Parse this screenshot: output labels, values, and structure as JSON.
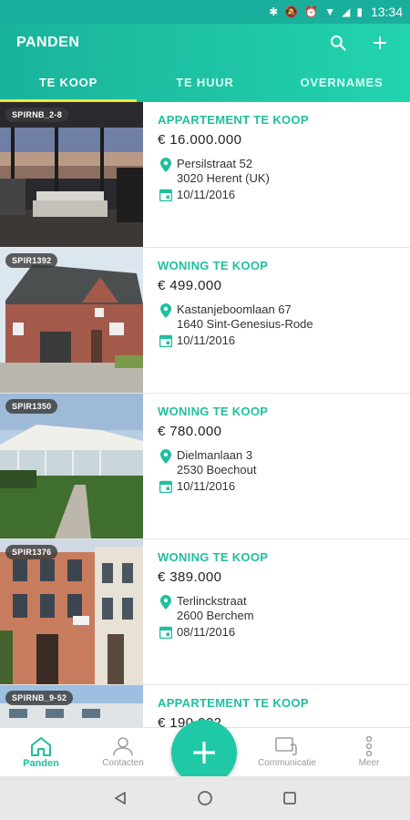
{
  "status": {
    "time": "13:34"
  },
  "appbar": {
    "title": "PANDEN"
  },
  "tabs": [
    {
      "label": "TE KOOP",
      "active": true
    },
    {
      "label": "TE HUUR",
      "active": false
    },
    {
      "label": "OVERNAMES",
      "active": false
    }
  ],
  "listings": [
    {
      "code": "SPIRNB_2-8",
      "type": "APPARTEMENT TE KOOP",
      "price": "€ 16.000.000",
      "street": "Persilstraat 52",
      "city": "3020 Herent (UK)",
      "date": "10/11/2016"
    },
    {
      "code": "SPIR1392",
      "type": "WONING TE KOOP",
      "price": "€ 499.000",
      "street": "Kastanjeboomlaan 67",
      "city": "1640 Sint-Genesius-Rode",
      "date": "10/11/2016"
    },
    {
      "code": "SPIR1350",
      "type": "WONING TE KOOP",
      "price": "€ 780.000",
      "street": "Dielmanlaan 3",
      "city": "2530 Boechout",
      "date": "10/11/2016"
    },
    {
      "code": "SPIR1376",
      "type": "WONING TE KOOP",
      "price": "€ 389.000",
      "street": "Terlinckstraat",
      "city": "2600 Berchem",
      "date": "08/11/2016"
    },
    {
      "code": "SPIRNB_9-52",
      "type": "APPARTEMENT TE KOOP",
      "price": "€ 190.002",
      "street": "",
      "city": "",
      "date": ""
    }
  ],
  "bottom_nav": [
    {
      "label": "Panden",
      "icon": "home-icon",
      "active": true
    },
    {
      "label": "Contacten",
      "icon": "person-icon",
      "active": false
    },
    {
      "label": "",
      "icon": "add-icon",
      "active": false
    },
    {
      "label": "Communicatie",
      "icon": "communication-icon",
      "active": false
    },
    {
      "label": "Meer",
      "icon": "more-vertical-icon",
      "active": false
    }
  ],
  "colors": {
    "accent": "#1fbf9f",
    "tab_indicator": "#f2e733",
    "appbar": "#1fc6a6"
  }
}
